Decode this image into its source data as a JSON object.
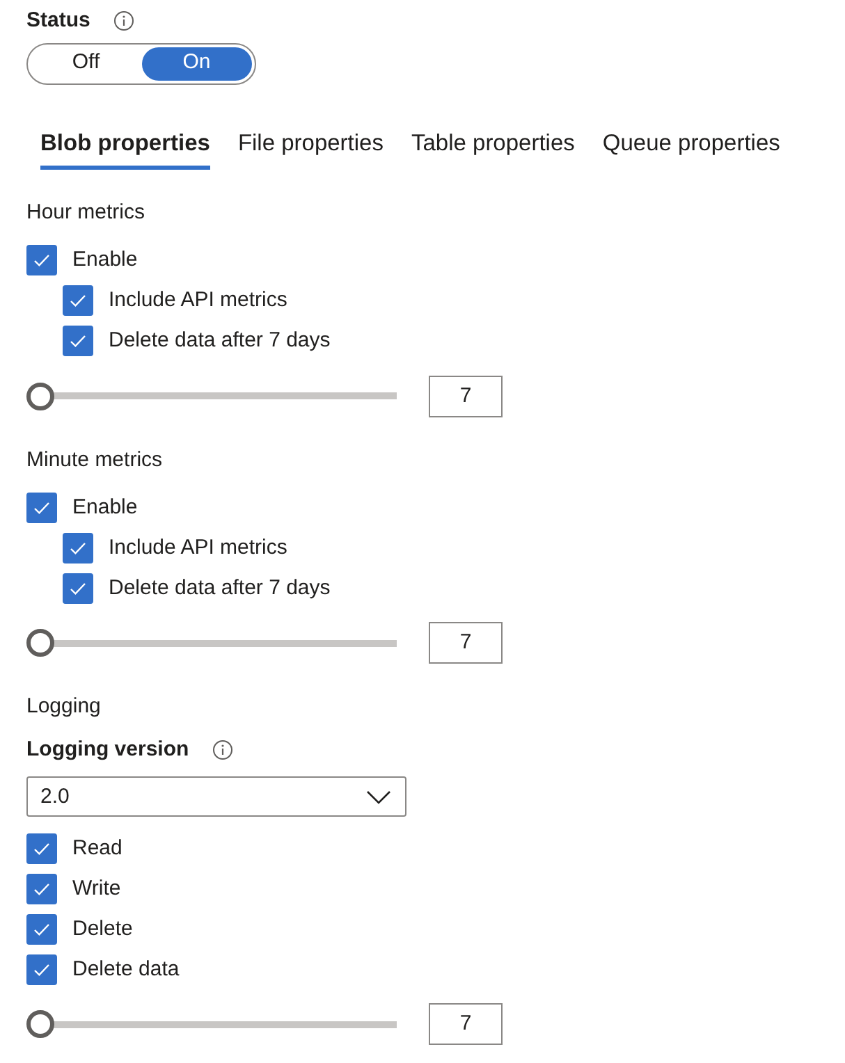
{
  "status": {
    "label": "Status",
    "segments": [
      {
        "label": "Off",
        "selected": false
      },
      {
        "label": "On",
        "selected": true
      }
    ]
  },
  "tabs": [
    {
      "label": "Blob properties",
      "selected": true
    },
    {
      "label": "File properties",
      "selected": false
    },
    {
      "label": "Table properties",
      "selected": false
    },
    {
      "label": "Queue properties",
      "selected": false
    }
  ],
  "sections": [
    {
      "title": "Hour metrics",
      "items": [
        {
          "kind": "checkbox",
          "label": "Enable",
          "checked": true,
          "children": [
            {
              "kind": "checkbox",
              "label": "Include API metrics",
              "checked": true
            },
            {
              "kind": "checkbox",
              "label": "Delete data after 7 days",
              "checked": true
            }
          ]
        },
        {
          "kind": "slider",
          "level": 0,
          "value": "7"
        }
      ]
    },
    {
      "title": "Minute metrics",
      "items": [
        {
          "kind": "checkbox",
          "label": "Enable",
          "checked": true,
          "children": [
            {
              "kind": "checkbox",
              "label": "Include API metrics",
              "checked": true
            },
            {
              "kind": "checkbox",
              "label": "Delete data after 7 days",
              "checked": true
            }
          ]
        },
        {
          "kind": "slider",
          "level": 0,
          "value": "7"
        }
      ]
    },
    {
      "title": "Logging",
      "items": [
        {
          "kind": "select",
          "label": "Logging version",
          "value": "2.0"
        },
        {
          "kind": "checkbox",
          "label": "Read",
          "checked": true
        },
        {
          "kind": "checkbox",
          "label": "Write",
          "checked": true
        },
        {
          "kind": "checkbox",
          "label": "Delete",
          "checked": true
        },
        {
          "kind": "checkbox",
          "label": "Delete data",
          "checked": true
        },
        {
          "kind": "slider",
          "level": 0,
          "value": "7"
        }
      ]
    }
  ]
}
